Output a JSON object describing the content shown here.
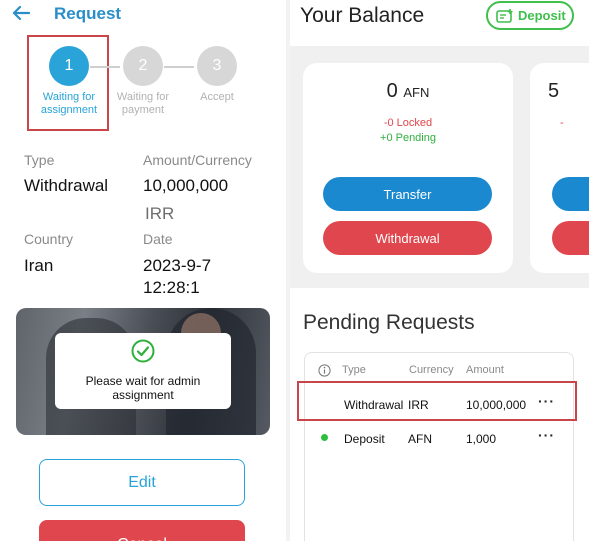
{
  "request": {
    "title": "Request",
    "steps": [
      {
        "number": "1",
        "label": "Waiting for assignment",
        "state": "active"
      },
      {
        "number": "2",
        "label": "Waiting for payment",
        "state": "inactive"
      },
      {
        "number": "3",
        "label": "Accept",
        "state": "inactive"
      }
    ],
    "type_label": "Type",
    "type_value": "Withdrawal",
    "amount_label": "Amount/Currency",
    "amount_value": "10,000,000",
    "currency_value": "IRR",
    "country_label": "Country",
    "country_value": "Iran",
    "date_label": "Date",
    "date_value": "2023-9-7",
    "time_value": "12:28:1",
    "wait_message": "Please wait for admin assignment",
    "edit_label": "Edit",
    "cancel_label": "Cancel"
  },
  "balance": {
    "title": "Your Balance",
    "deposit_label": "Deposit",
    "card": {
      "amount": "0",
      "currency": "AFN",
      "locked": "-0 Locked",
      "pending": "+0 Pending",
      "transfer_label": "Transfer",
      "withdrawal_label": "Withdrawal"
    },
    "card2_amount": "5",
    "card2_dash": "-"
  },
  "pending_requests": {
    "title": "Pending Requests",
    "columns": [
      "Type",
      "Currency",
      "Amount"
    ],
    "rows": [
      {
        "type": "Withdrawal",
        "currency": "IRR",
        "amount": "10,000,000",
        "actions": "···"
      },
      {
        "type": "Deposit",
        "currency": "AFN",
        "amount": "1,000",
        "actions": "···"
      }
    ]
  },
  "colors": {
    "accent_blue": "#29a3d8",
    "transfer_blue": "#1b89cf",
    "danger_red": "#e0464d",
    "success_green": "#3fbf4b",
    "highlight_red": "#c8454a"
  },
  "icons": [
    "back-arrow-icon",
    "check-circle-icon",
    "wallet-plus-icon",
    "info-icon",
    "more-dots-icon",
    "status-dot-icon"
  ]
}
